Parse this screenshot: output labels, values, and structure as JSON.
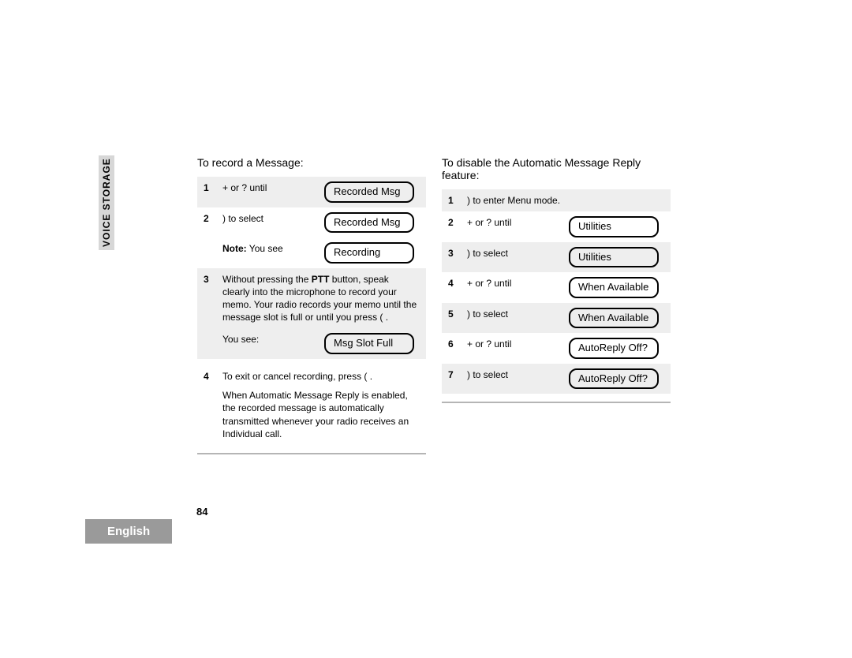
{
  "section_tab": "VOICE STORAGE",
  "page_number": "84",
  "language": "English",
  "left": {
    "heading": "To record a Message:",
    "rows": {
      "r1": {
        "num": "1",
        "text": "+      or  ?      until",
        "chip": "Recorded Msg"
      },
      "r2": {
        "num": "2",
        "text": ")       to select",
        "chip": "Recorded Msg"
      },
      "r2note_label": "Note:",
      "r2note_text": " You see",
      "r2note_chip": "Recording",
      "r3": {
        "num": "3",
        "text_a": "Without pressing the ",
        "text_bold": "PTT",
        "text_b": " button, speak clearly into the microphone to record your memo. Your radio records your memo until the message slot is full or until you press (     .",
        "you_see": "You see:",
        "chip": "Msg Slot Full"
      },
      "r4": {
        "num": "4",
        "line1": "To exit or cancel recording, press (       .",
        "line2": "When Automatic Message Reply is enabled, the recorded message is automatically transmitted whenever your radio receives an Individual call."
      }
    }
  },
  "right": {
    "heading": "To disable the Automatic Message Reply feature:",
    "rows": {
      "r1": {
        "num": "1",
        "text": ")        to enter Menu mode."
      },
      "r2": {
        "num": "2",
        "text": "+      or  ?      until",
        "chip": "Utilities"
      },
      "r3": {
        "num": "3",
        "text": ")        to select",
        "chip": "Utilities"
      },
      "r4": {
        "num": "4",
        "text": "+      or  ?      until",
        "chip": "When Available"
      },
      "r5": {
        "num": "5",
        "text": ")        to select",
        "chip": "When Available"
      },
      "r6": {
        "num": "6",
        "text": "+      or  ?      until",
        "chip": "AutoReply Off?"
      },
      "r7": {
        "num": "7",
        "text": ")        to select",
        "chip": "AutoReply Off?"
      }
    }
  }
}
